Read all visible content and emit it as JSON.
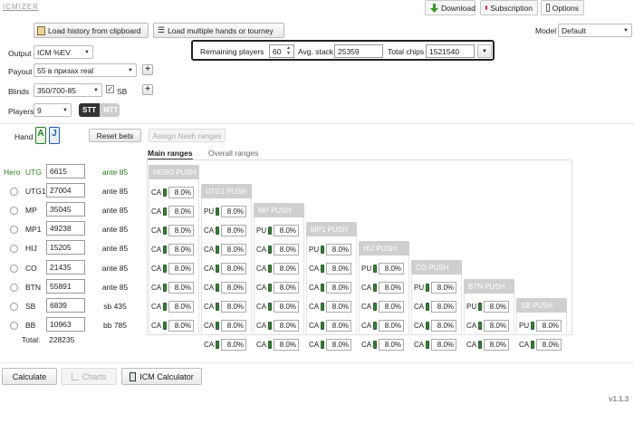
{
  "app": {
    "brand": "ICMIZER",
    "version": "v1.1.3"
  },
  "top": {
    "download": "Download",
    "subscription": "Subscription",
    "options": "Options"
  },
  "toolbar": {
    "load_history": "Load history from clipboard",
    "load_multiple": "Load multiple hands or tourney",
    "model_label": "Model",
    "model_value": "Default"
  },
  "chipbox": {
    "remaining_label": "Remaining players",
    "remaining_value": "60",
    "avg_label": "Avg. stack",
    "avg_value": "25359",
    "total_label": "Total chips",
    "total_value": "1521540"
  },
  "settings": {
    "output_label": "Output",
    "output_value": "ICM %EV",
    "payout_label": "Payout",
    "payout_value": "55 в призах real",
    "blinds_label": "Blinds",
    "blinds_value": "350/700-85",
    "sb_label": "SB",
    "players_label": "Players",
    "players_value": "9",
    "stt_label": "STT",
    "mtt_label": "MTT"
  },
  "hand": {
    "label": "Hand",
    "card1": "A",
    "card2": "J",
    "reset": "Reset bets",
    "assign_nash": "Assign Nash ranges"
  },
  "tabs": {
    "main": "Main ranges",
    "overall": "Overall ranges"
  },
  "players": [
    {
      "pos": "UTG",
      "hero": "Hero",
      "stack": "6615",
      "ante": "ante 85"
    },
    {
      "pos": "UTG1",
      "stack": "27004",
      "ante": "ante 85"
    },
    {
      "pos": "MP",
      "stack": "35045",
      "ante": "ante 85"
    },
    {
      "pos": "MP1",
      "stack": "49238",
      "ante": "ante 85"
    },
    {
      "pos": "HIJ",
      "stack": "15205",
      "ante": "ante 85"
    },
    {
      "pos": "CO",
      "stack": "21435",
      "ante": "ante 85"
    },
    {
      "pos": "BTN",
      "stack": "55891",
      "ante": "ante 85"
    },
    {
      "pos": "SB",
      "stack": "6839",
      "ante": "sb 435"
    },
    {
      "pos": "BB",
      "stack": "10963",
      "ante": "bb 785"
    }
  ],
  "total": {
    "label": "Total:",
    "value": "228235"
  },
  "columns": [
    {
      "title": "HERO PUSH",
      "cells": [
        {
          "tag": "CA",
          "pct": "8.0%"
        },
        {
          "tag": "CA",
          "pct": "8.0%"
        },
        {
          "tag": "CA",
          "pct": "8.0%"
        },
        {
          "tag": "CA",
          "pct": "8.0%"
        },
        {
          "tag": "CA",
          "pct": "8.0%"
        },
        {
          "tag": "CA",
          "pct": "8.0%"
        },
        {
          "tag": "CA",
          "pct": "8.0%"
        },
        {
          "tag": "CA",
          "pct": "8.0%"
        }
      ]
    },
    {
      "title": "UTG1 PUSH",
      "cells": [
        {
          "tag": "PU",
          "pct": "8.0%"
        },
        {
          "tag": "CA",
          "pct": "8.0%"
        },
        {
          "tag": "CA",
          "pct": "8.0%"
        },
        {
          "tag": "CA",
          "pct": "8.0%"
        },
        {
          "tag": "CA",
          "pct": "8.0%"
        },
        {
          "tag": "CA",
          "pct": "8.0%"
        },
        {
          "tag": "CA",
          "pct": "8.0%"
        },
        {
          "tag": "CA",
          "pct": "8.0%"
        }
      ]
    },
    {
      "title": "MP PUSH",
      "cells": [
        {
          "tag": "PU",
          "pct": "8.0%"
        },
        {
          "tag": "CA",
          "pct": "8.0%"
        },
        {
          "tag": "CA",
          "pct": "8.0%"
        },
        {
          "tag": "CA",
          "pct": "8.0%"
        },
        {
          "tag": "CA",
          "pct": "8.0%"
        },
        {
          "tag": "CA",
          "pct": "8.0%"
        },
        {
          "tag": "CA",
          "pct": "8.0%"
        }
      ]
    },
    {
      "title": "MP1 PUSH",
      "cells": [
        {
          "tag": "PU",
          "pct": "8.0%"
        },
        {
          "tag": "CA",
          "pct": "8.0%"
        },
        {
          "tag": "CA",
          "pct": "8.0%"
        },
        {
          "tag": "CA",
          "pct": "8.0%"
        },
        {
          "tag": "CA",
          "pct": "8.0%"
        },
        {
          "tag": "CA",
          "pct": "8.0%"
        }
      ]
    },
    {
      "title": "HIJ PUSH",
      "cells": [
        {
          "tag": "PU",
          "pct": "8.0%"
        },
        {
          "tag": "CA",
          "pct": "8.0%"
        },
        {
          "tag": "CA",
          "pct": "8.0%"
        },
        {
          "tag": "CA",
          "pct": "8.0%"
        },
        {
          "tag": "CA",
          "pct": "8.0%"
        }
      ]
    },
    {
      "title": "CO PUSH",
      "cells": [
        {
          "tag": "PU",
          "pct": "8.0%"
        },
        {
          "tag": "CA",
          "pct": "8.0%"
        },
        {
          "tag": "CA",
          "pct": "8.0%"
        },
        {
          "tag": "CA",
          "pct": "8.0%"
        }
      ]
    },
    {
      "title": "BTN PUSH",
      "cells": [
        {
          "tag": "PU",
          "pct": "8.0%"
        },
        {
          "tag": "CA",
          "pct": "8.0%"
        },
        {
          "tag": "CA",
          "pct": "8.0%"
        }
      ]
    },
    {
      "title": "SB PUSH",
      "cells": [
        {
          "tag": "PU",
          "pct": "8.0%"
        },
        {
          "tag": "CA",
          "pct": "8.0%"
        }
      ]
    }
  ],
  "bottom": {
    "calculate": "Calculate",
    "charts": "Charts",
    "icm_calculator": "ICM Calculator"
  },
  "colors": {
    "hero_green": "#2e7d1e",
    "download_green": "#3a9a2a",
    "sub_red": "#d32020"
  }
}
